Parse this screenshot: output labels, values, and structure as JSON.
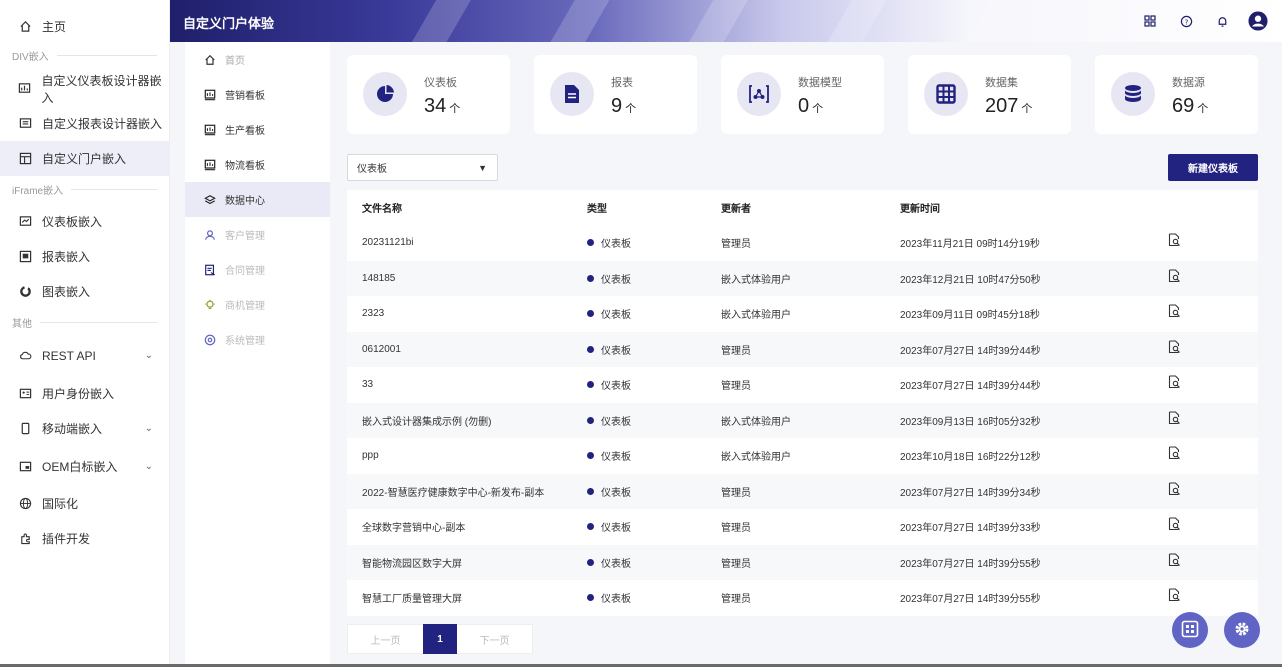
{
  "outer_nav": {
    "home": "主页",
    "sec_div": "DIV嵌入",
    "items_div": [
      "自定义仪表板设计器嵌入",
      "自定义报表设计器嵌入",
      "自定义门户嵌入"
    ],
    "sec_iframe": "iFrame嵌入",
    "items_iframe": [
      "仪表板嵌入",
      "报表嵌入",
      "图表嵌入"
    ],
    "sec_other": "其他",
    "items_other": [
      "REST API",
      "用户身份嵌入",
      "移动端嵌入",
      "OEM白标嵌入",
      "国际化",
      "插件开发"
    ]
  },
  "header": {
    "title": "自定义门户体验"
  },
  "inner_nav": [
    "首页",
    "营销看板",
    "生产看板",
    "物流看板",
    "数据中心",
    "客户管理",
    "合同管理",
    "商机管理",
    "系统管理"
  ],
  "cards": [
    {
      "label": "仪表板",
      "value": "34",
      "unit": "个",
      "icon": "pie-chart-icon"
    },
    {
      "label": "报表",
      "value": "9",
      "unit": "个",
      "icon": "document-icon"
    },
    {
      "label": "数据模型",
      "value": "0",
      "unit": "个",
      "icon": "model-icon"
    },
    {
      "label": "数据集",
      "value": "207",
      "unit": "个",
      "icon": "table-icon"
    },
    {
      "label": "数据源",
      "value": "69",
      "unit": "个",
      "icon": "database-icon"
    }
  ],
  "filter": {
    "selected": "仪表板"
  },
  "new_button": "新建仪表板",
  "table": {
    "headers": [
      "文件名称",
      "类型",
      "更新者",
      "更新时间"
    ],
    "rows": [
      [
        "20231121bi",
        "仪表板",
        "管理员",
        "2023年11月21日 09时14分19秒"
      ],
      [
        "148185",
        "仪表板",
        "嵌入式体验用户",
        "2023年12月21日 10时47分50秒"
      ],
      [
        "2323",
        "仪表板",
        "嵌入式体验用户",
        "2023年09月11日 09时45分18秒"
      ],
      [
        "0612001",
        "仪表板",
        "管理员",
        "2023年07月27日 14时39分44秒"
      ],
      [
        "33",
        "仪表板",
        "管理员",
        "2023年07月27日 14时39分44秒"
      ],
      [
        "嵌入式设计器集成示例 (勿删)",
        "仪表板",
        "嵌入式体验用户",
        "2023年09月13日 16时05分32秒"
      ],
      [
        "ppp",
        "仪表板",
        "嵌入式体验用户",
        "2023年10月18日 16时22分12秒"
      ],
      [
        "2022-智慧医疗健康数字中心-新发布-副本",
        "仪表板",
        "管理员",
        "2023年07月27日 14时39分34秒"
      ],
      [
        "全球数字营销中心-副本",
        "仪表板",
        "管理员",
        "2023年07月27日 14时39分33秒"
      ],
      [
        "智能物流园区数字大屏",
        "仪表板",
        "管理员",
        "2023年07月27日 14时39分55秒"
      ],
      [
        "智慧工厂质量管理大屏",
        "仪表板",
        "管理员",
        "2023年07月27日 14时39分55秒"
      ]
    ]
  },
  "pager": {
    "prev": "上一页",
    "current": "1",
    "next": "下一页"
  },
  "colors": {
    "brand": "#222280",
    "accent": "#6064c4"
  }
}
